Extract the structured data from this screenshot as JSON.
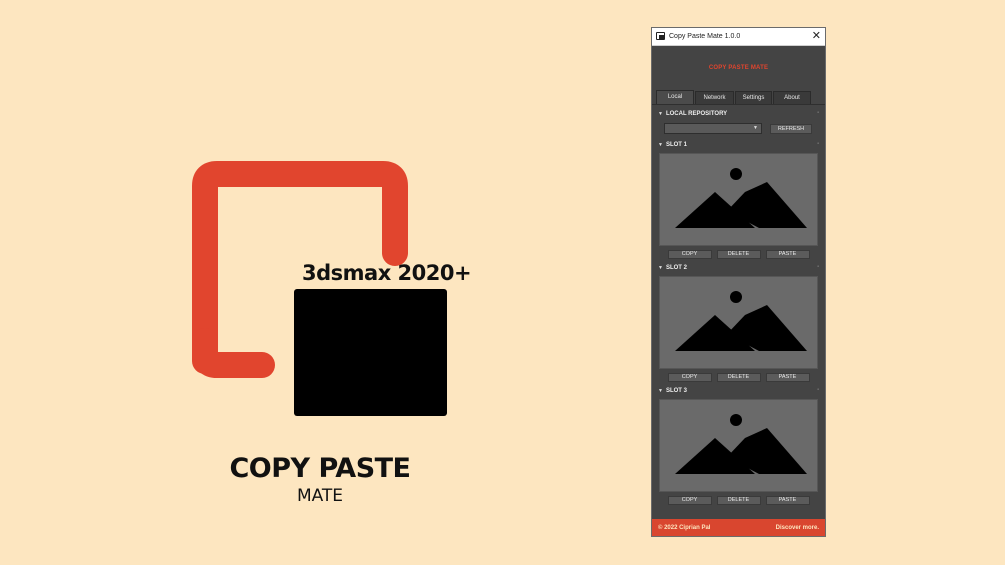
{
  "promo": {
    "version_label": "3dsmax 2020+",
    "brand_title": "COPY PASTE",
    "brand_subtitle": "MATE",
    "accent_color": "#e1452e",
    "background_color": "#fde6c0"
  },
  "window": {
    "title": "Copy Paste Mate 1.0.0",
    "close_icon": "close-icon",
    "banner": "COPY PASTE MATE",
    "tabs": [
      {
        "label": "Local",
        "active": true
      },
      {
        "label": "Network",
        "active": false
      },
      {
        "label": "Settings",
        "active": false
      },
      {
        "label": "About",
        "active": false
      }
    ],
    "repository": {
      "heading": "LOCAL REPOSITORY",
      "selected": "",
      "refresh_label": "REFRESH"
    },
    "slots": [
      {
        "heading": "SLOT 1",
        "copy": "COPY",
        "delete": "DELETE",
        "paste": "PASTE"
      },
      {
        "heading": "SLOT 2",
        "copy": "COPY",
        "delete": "DELETE",
        "paste": "PASTE"
      },
      {
        "heading": "SLOT 3",
        "copy": "COPY",
        "delete": "DELETE",
        "paste": "PASTE"
      }
    ],
    "footer": {
      "copyright": "© 2022 Ciprian Pal",
      "link": "Discover more."
    }
  }
}
